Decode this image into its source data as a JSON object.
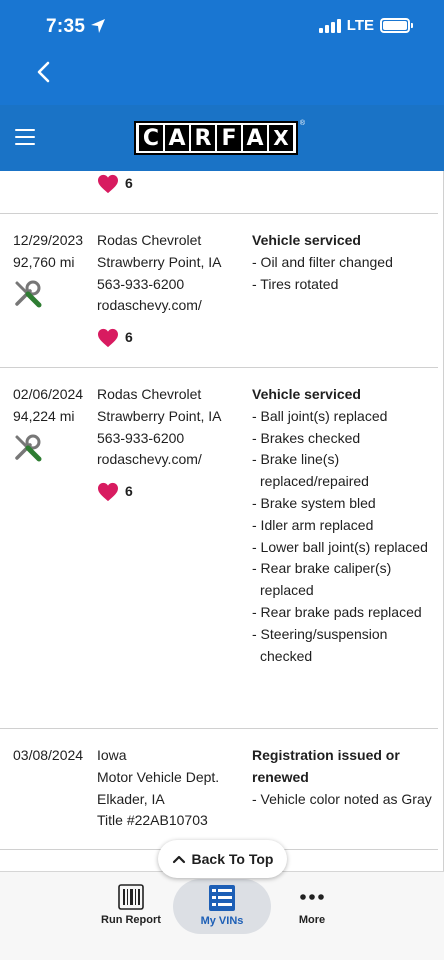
{
  "status_bar": {
    "time": "7:35",
    "network": "LTE"
  },
  "nav": {
    "back_icon": "chevron-left-icon"
  },
  "app_bar": {
    "menu_icon": "hamburger-menu-icon",
    "logo_letters": [
      "C",
      "A",
      "R",
      "F",
      "A",
      "X"
    ],
    "logo_registered": "®"
  },
  "records": [
    {
      "date": "",
      "mileage": "",
      "source": [],
      "likes": "6",
      "comments_heading": "",
      "comments": []
    },
    {
      "date": "12/29/2023",
      "mileage": "92,760 mi",
      "source": [
        "Rodas Chevrolet",
        "Strawberry Point, IA",
        "563-933-6200",
        "rodaschevy.com/"
      ],
      "likes": "6",
      "comments_heading": "Vehicle serviced",
      "comments": [
        "- Oil and filter changed",
        "- Tires rotated"
      ]
    },
    {
      "date": "02/06/2024",
      "mileage": "94,224 mi",
      "source": [
        "Rodas Chevrolet",
        "Strawberry Point, IA",
        "563-933-6200",
        "rodaschevy.com/"
      ],
      "likes": "6",
      "comments_heading": "Vehicle serviced",
      "comments": [
        "- Ball joint(s) replaced",
        "- Brakes checked",
        "- Brake line(s) replaced/repaired",
        "- Brake system bled",
        "- Idler arm replaced",
        "- Lower ball joint(s) replaced",
        "- Rear brake caliper(s) replaced",
        "- Rear brake pads replaced",
        "- Steering/suspension checked"
      ]
    },
    {
      "date": "03/08/2024",
      "mileage": "",
      "source": [
        "Iowa",
        "Motor Vehicle Dept.",
        "Elkader, IA",
        "Title #22AB10703"
      ],
      "likes": "",
      "comments_heading": "Registration issued or renewed",
      "comments": [
        "- Vehicle color noted as Gray"
      ]
    }
  ],
  "back_to_top": {
    "label": "Back To Top"
  },
  "tabs": [
    {
      "label": "Run Report",
      "icon": "barcode-icon"
    },
    {
      "label": "My VINs",
      "icon": "vin-list-icon",
      "selected": true
    },
    {
      "label": "More",
      "icon": "more-dots-icon"
    }
  ],
  "colors": {
    "header_blue": "#1976d2",
    "app_bar_blue": "#1a73c6",
    "heart": "#d81b60",
    "tools_green": "#2e7d32",
    "selected_tab": "#1d5fb6"
  }
}
